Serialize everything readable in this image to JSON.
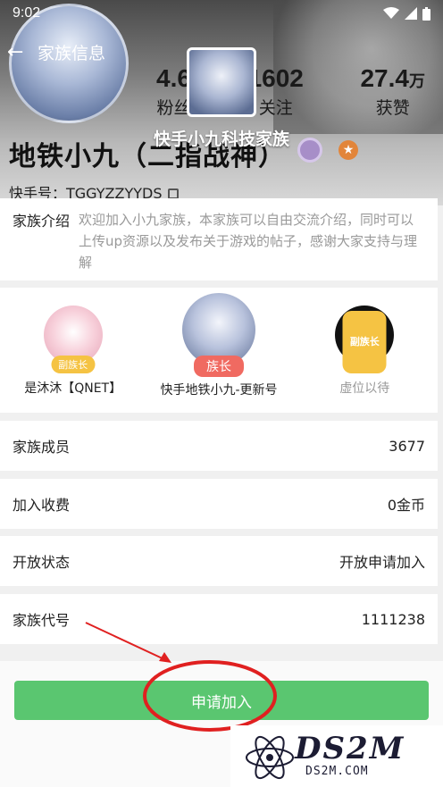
{
  "status_bar": {
    "time": "9:02"
  },
  "topbar": {
    "title": "家族信息"
  },
  "family": {
    "name": "快手小九科技家族"
  },
  "profile": {
    "name": "地铁小九（二指战神）",
    "id_label": "快手号：TGGYZZYYDS",
    "stats": [
      {
        "value": "4.6",
        "unit": "",
        "label": "粉丝"
      },
      {
        "value": "1602",
        "unit": "",
        "label": "关注"
      },
      {
        "value": "27.4",
        "unit": "万",
        "label": "获赞"
      }
    ]
  },
  "intro": {
    "label": "家族介绍",
    "text": "欢迎加入小九家族，本家族可以自由交流介绍，同时可以上传up资源以及发布关于游戏的帖子，感谢大家支持与理解"
  },
  "members": [
    {
      "name": "是沐沐【QNET】",
      "role": "副族长"
    },
    {
      "name": "快手地铁小九-更新号",
      "role": "族长"
    },
    {
      "name": "虚位以待",
      "role": "副族长",
      "placeholder": "?"
    }
  ],
  "rows": [
    {
      "label": "家族成员",
      "value": "3677"
    },
    {
      "label": "加入收费",
      "value": "0金币"
    },
    {
      "label": "开放状态",
      "value": "开放申请加入"
    },
    {
      "label": "家族代号",
      "value": "1111238"
    }
  ],
  "apply_button": "申请加入",
  "watermark": {
    "logo": "DS2M",
    "site": "DS2M.COM"
  },
  "colors": {
    "accent": "#5ac670",
    "leader_tag": "#f06a61",
    "deputy_tag": "#f5c343",
    "annotation": "#e02020"
  }
}
